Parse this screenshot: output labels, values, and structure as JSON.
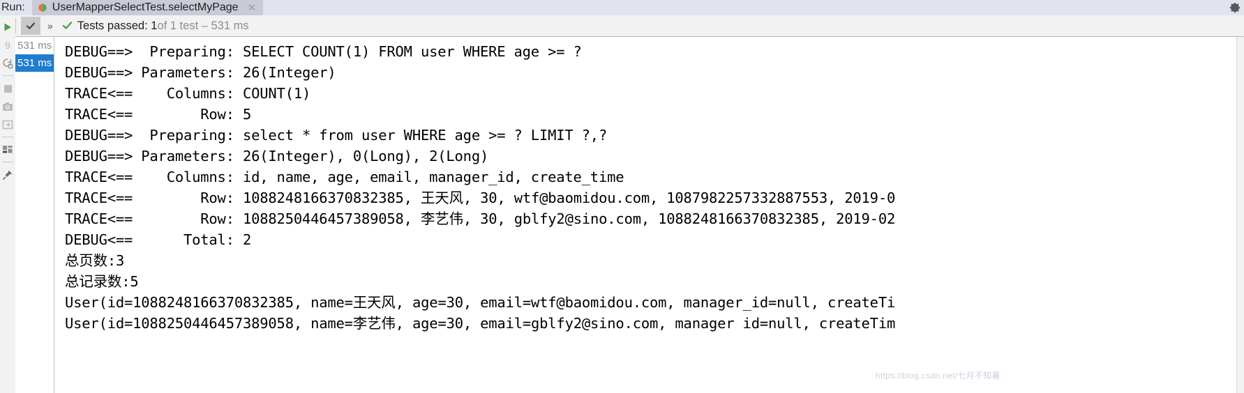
{
  "window": {
    "run_label": "Run:",
    "gear_icon": "gear-icon"
  },
  "tab": {
    "title": "UserMapperSelectTest.selectMyPage",
    "close_label": "✕",
    "icon": "run-test-icon"
  },
  "toolbar": {
    "rerun_icon": "rerun-green-play-icon",
    "toggle_checkbox_icon": "check-mark-icon",
    "expand_icon": "»",
    "status_check_icon": "green-check-icon",
    "status_passed": "Tests passed: 1",
    "status_detail": " of 1 test – 531 ms"
  },
  "rail": {
    "items": [
      {
        "name": "rerun-play-icon",
        "glyph": "play"
      },
      {
        "name": "rerun-failed-icon",
        "glyph": "9"
      },
      {
        "name": "rerun-automatically-icon",
        "glyph": "loop"
      },
      {
        "name": "stop-icon",
        "glyph": "square"
      },
      {
        "name": "export-test-results-icon",
        "glyph": "camera"
      },
      {
        "name": "import-test-results-icon",
        "glyph": "import"
      },
      {
        "name": "layout-settings-icon",
        "glyph": "layout"
      },
      {
        "name": "pin-tab-icon",
        "glyph": "pin"
      }
    ]
  },
  "tree": {
    "rows": [
      {
        "label": "531 ms",
        "selected": false
      },
      {
        "label": "531 ms",
        "selected": true
      }
    ]
  },
  "console": {
    "lines": [
      "DEBUG==>  Preparing: SELECT COUNT(1) FROM user WHERE age >= ?",
      "DEBUG==> Parameters: 26(Integer)",
      "TRACE<==    Columns: COUNT(1)",
      "TRACE<==        Row: 5",
      "DEBUG==>  Preparing: select * from user WHERE age >= ? LIMIT ?,?",
      "DEBUG==> Parameters: 26(Integer), 0(Long), 2(Long)",
      "TRACE<==    Columns: id, name, age, email, manager_id, create_time",
      "TRACE<==        Row: 1088248166370832385, 王天风, 30, wtf@baomidou.com, 1087982257332887553, 2019-0",
      "TRACE<==        Row: 1088250446457389058, 李艺伟, 30, gblfy2@sino.com, 1088248166370832385, 2019-02",
      "DEBUG<==      Total: 2",
      "总页数:3",
      "总记录数:5",
      "User(id=1088248166370832385, name=王天风, age=30, email=wtf@baomidou.com, manager_id=null, createTi",
      "User(id=1088250446457389058, name=李艺伟, age=30, email=gblfy2@sino.com, manager id=null, createTim"
    ]
  },
  "watermark": {
    "text": "https://blog.csdn.net/七月不知暑"
  },
  "colors": {
    "tabbar_bg": "#e1e4ed",
    "tab_active_bg": "#c9ccd6",
    "toolbar_bg": "#f2f2f2",
    "selection_blue": "#1f7cce",
    "green": "#4a9e4a",
    "console_fg": "#000000"
  }
}
